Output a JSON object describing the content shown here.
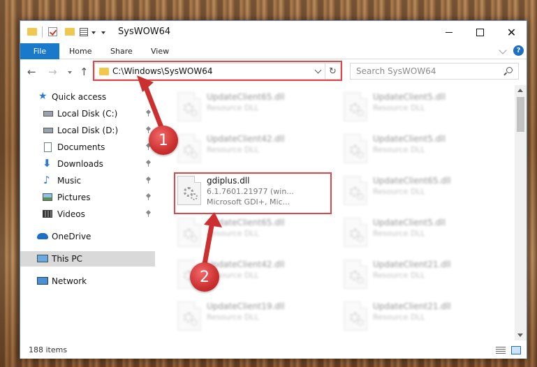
{
  "window": {
    "title": "SysWOW64",
    "controls": {
      "minimize": "",
      "maximize": "",
      "close": "✕"
    }
  },
  "ribbon": {
    "file_tab": "File",
    "tabs": [
      "Home",
      "Share",
      "View"
    ],
    "help": "?"
  },
  "address_bar": {
    "path": "C:\\Windows\\SysWOW64",
    "refresh": "↻"
  },
  "search": {
    "placeholder": "Search SysWOW64"
  },
  "sidebar": {
    "items": [
      {
        "label": "Quick access",
        "icon": "star-icon"
      },
      {
        "label": "Local Disk (C:)",
        "icon": "drive-icon",
        "pinned": true
      },
      {
        "label": "Local Disk (D:)",
        "icon": "drive-icon",
        "pinned": true
      },
      {
        "label": "Documents",
        "icon": "documents-icon",
        "pinned": true
      },
      {
        "label": "Downloads",
        "icon": "downloads-icon",
        "pinned": true
      },
      {
        "label": "Music",
        "icon": "music-icon",
        "pinned": true
      },
      {
        "label": "Pictures",
        "icon": "pictures-icon",
        "pinned": true
      },
      {
        "label": "Videos",
        "icon": "videos-icon",
        "pinned": true
      },
      {
        "label": "OneDrive",
        "icon": "cloud-icon"
      },
      {
        "label": "This PC",
        "icon": "computer-icon",
        "selected": true
      },
      {
        "label": "Network",
        "icon": "network-icon"
      }
    ]
  },
  "files": {
    "left": [
      {
        "name": "UpdateClient65.dll",
        "type": "Resource DLL"
      },
      {
        "name": "UpdateClient42.dll",
        "type": "Resource DLL"
      },
      {
        "name": "UpdateClient65.dll",
        "type": "Resource DLL"
      },
      {
        "name": "UpdateClient42.dll",
        "type": "Resource DLL"
      },
      {
        "name": "UpdateClient19.dll",
        "type": "Resource DLL"
      }
    ],
    "right": [
      {
        "name": "UpdateClient5.dll",
        "type": "Resource DLL"
      },
      {
        "name": "UpdateClient5.dll",
        "type": "Resource DLL"
      },
      {
        "name": "UpdateClient65.dll",
        "type": "Resource DLL"
      },
      {
        "name": "UpdateClient5.dll",
        "type": "Resource DLL"
      },
      {
        "name": "UpdateClient21.dll",
        "type": "Resource DLL"
      },
      {
        "name": "UpdateClient21.dll",
        "type": "Resource DLL"
      }
    ],
    "highlighted": {
      "name": "gdiplus.dll",
      "version": "6.1.7601.21977 (win...",
      "description": "Microsoft GDI+, Mic..."
    }
  },
  "status": {
    "item_count": "188 items"
  },
  "callouts": {
    "one": "1",
    "two": "2"
  },
  "colors": {
    "accent": "#1979ca",
    "highlight": "#e14545",
    "badge": "#cc2f2f"
  }
}
